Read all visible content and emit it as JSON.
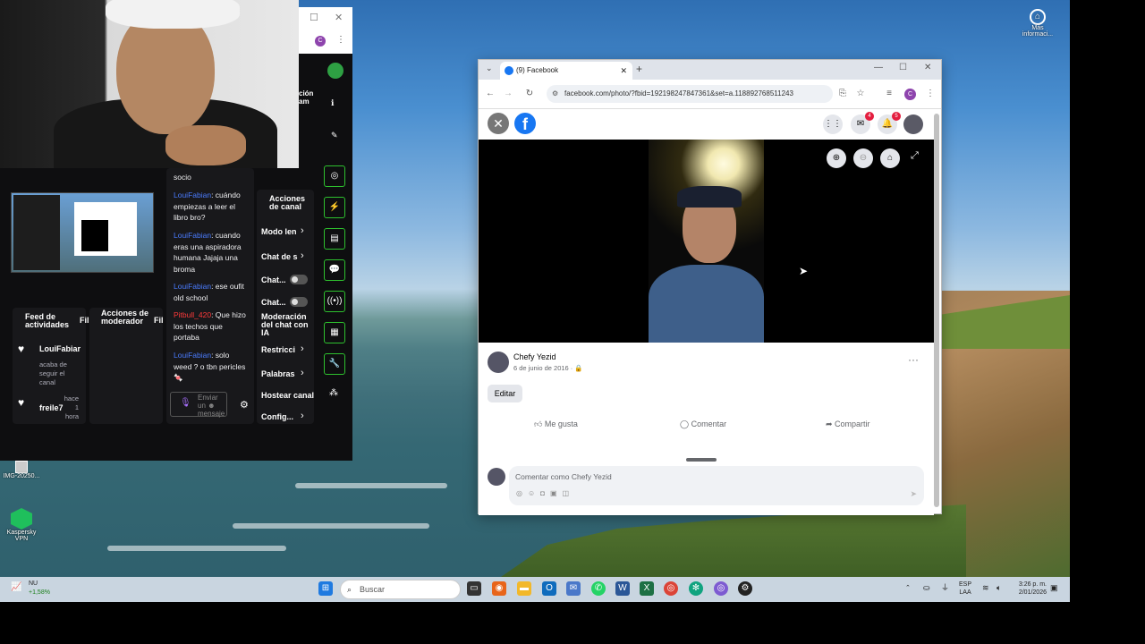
{
  "desktop": {
    "icons": [
      {
        "label": "IMG-20250..."
      },
      {
        "label": "Kaspersky VPN"
      },
      {
        "label": "Más informaci..."
      }
    ]
  },
  "twitch": {
    "right_header": "ción am",
    "feed_header": "Feed de actividades",
    "feed_filter": "Fil",
    "mod_actions_header": "Acciones de moderador",
    "mod_filter": "Fil",
    "feed_items": [
      {
        "user": "LouiFabiar",
        "text": "acaba de seguir el canal"
      },
      {
        "user": "freile7",
        "time": "hace 1 hora"
      }
    ],
    "chat_top": "socio",
    "chat_messages": [
      {
        "user": "LouiFabian",
        "text": ": cuándo empiezas a leer el libro bro?"
      },
      {
        "user": "LouiFabian",
        "text": ": cuando eras una aspiradora humana Jajaja una broma"
      },
      {
        "user": "LouiFabian",
        "text": ": ese oufit old school"
      },
      {
        "user": "Pitbull_420",
        "text": ": Que hizo los techos que portaba"
      },
      {
        "user": "LouiFabian",
        "text": ": solo weed ? o tbn pericles 🍬"
      }
    ],
    "chat_input_placeholder": "Enviar un ☻ mensaje",
    "channel_actions_header": "Acciones de canal",
    "channel_actions": [
      {
        "label": "Modo len"
      },
      {
        "label": "Chat de s"
      },
      {
        "label": "Chat..."
      },
      {
        "label": "Chat..."
      },
      {
        "label": "Moderación del chat con IA"
      },
      {
        "label": "Restricci"
      },
      {
        "label": "Palabras"
      },
      {
        "label": "Hostear canal"
      },
      {
        "label": "Config..."
      }
    ]
  },
  "browser": {
    "tab_title": "(9) Facebook",
    "url": "facebook.com/photo/?fbid=192198247847361&set=a.118892768511243",
    "profile_initial": "C",
    "fb_badges": {
      "messenger": "4",
      "notifications": "5"
    },
    "post": {
      "author": "Chefy Yezid",
      "date": "6 de junio de 2016 · 🔒",
      "edit_label": "Editar",
      "like_label": "Me gusta",
      "comment_label": "Comentar",
      "share_label": "Compartir",
      "comment_placeholder": "Comentar como Chefy Yezid"
    }
  },
  "taskbar": {
    "weather_temp": "NU",
    "weather_change": "+1,58%",
    "search_placeholder": "Buscar",
    "lang_top": "ESP",
    "lang_bottom": "LAA",
    "time": "3:26 p. m.",
    "date": "2/01/2026"
  },
  "colors": {
    "facebook_blue": "#1877f2",
    "twitch_bg": "#0e0e10",
    "twitch_green": "#2ec12e",
    "twitch_blue_user": "#4a7cff"
  }
}
